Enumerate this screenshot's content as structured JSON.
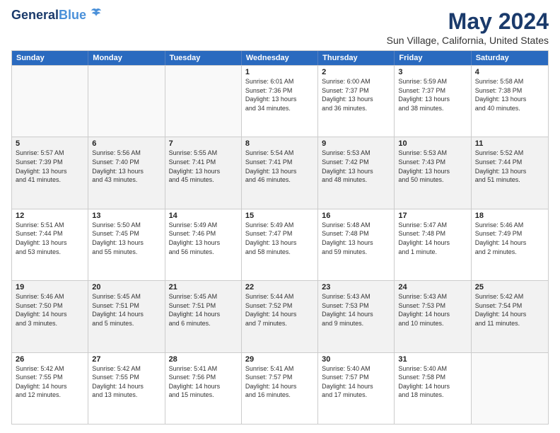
{
  "logo": {
    "line1": "General",
    "line2": "Blue"
  },
  "title": "May 2024",
  "subtitle": "Sun Village, California, United States",
  "headers": [
    "Sunday",
    "Monday",
    "Tuesday",
    "Wednesday",
    "Thursday",
    "Friday",
    "Saturday"
  ],
  "weeks": [
    [
      {
        "day": "",
        "info": ""
      },
      {
        "day": "",
        "info": ""
      },
      {
        "day": "",
        "info": ""
      },
      {
        "day": "1",
        "info": "Sunrise: 6:01 AM\nSunset: 7:36 PM\nDaylight: 13 hours\nand 34 minutes."
      },
      {
        "day": "2",
        "info": "Sunrise: 6:00 AM\nSunset: 7:37 PM\nDaylight: 13 hours\nand 36 minutes."
      },
      {
        "day": "3",
        "info": "Sunrise: 5:59 AM\nSunset: 7:37 PM\nDaylight: 13 hours\nand 38 minutes."
      },
      {
        "day": "4",
        "info": "Sunrise: 5:58 AM\nSunset: 7:38 PM\nDaylight: 13 hours\nand 40 minutes."
      }
    ],
    [
      {
        "day": "5",
        "info": "Sunrise: 5:57 AM\nSunset: 7:39 PM\nDaylight: 13 hours\nand 41 minutes."
      },
      {
        "day": "6",
        "info": "Sunrise: 5:56 AM\nSunset: 7:40 PM\nDaylight: 13 hours\nand 43 minutes."
      },
      {
        "day": "7",
        "info": "Sunrise: 5:55 AM\nSunset: 7:41 PM\nDaylight: 13 hours\nand 45 minutes."
      },
      {
        "day": "8",
        "info": "Sunrise: 5:54 AM\nSunset: 7:41 PM\nDaylight: 13 hours\nand 46 minutes."
      },
      {
        "day": "9",
        "info": "Sunrise: 5:53 AM\nSunset: 7:42 PM\nDaylight: 13 hours\nand 48 minutes."
      },
      {
        "day": "10",
        "info": "Sunrise: 5:53 AM\nSunset: 7:43 PM\nDaylight: 13 hours\nand 50 minutes."
      },
      {
        "day": "11",
        "info": "Sunrise: 5:52 AM\nSunset: 7:44 PM\nDaylight: 13 hours\nand 51 minutes."
      }
    ],
    [
      {
        "day": "12",
        "info": "Sunrise: 5:51 AM\nSunset: 7:44 PM\nDaylight: 13 hours\nand 53 minutes."
      },
      {
        "day": "13",
        "info": "Sunrise: 5:50 AM\nSunset: 7:45 PM\nDaylight: 13 hours\nand 55 minutes."
      },
      {
        "day": "14",
        "info": "Sunrise: 5:49 AM\nSunset: 7:46 PM\nDaylight: 13 hours\nand 56 minutes."
      },
      {
        "day": "15",
        "info": "Sunrise: 5:49 AM\nSunset: 7:47 PM\nDaylight: 13 hours\nand 58 minutes."
      },
      {
        "day": "16",
        "info": "Sunrise: 5:48 AM\nSunset: 7:48 PM\nDaylight: 13 hours\nand 59 minutes."
      },
      {
        "day": "17",
        "info": "Sunrise: 5:47 AM\nSunset: 7:48 PM\nDaylight: 14 hours\nand 1 minute."
      },
      {
        "day": "18",
        "info": "Sunrise: 5:46 AM\nSunset: 7:49 PM\nDaylight: 14 hours\nand 2 minutes."
      }
    ],
    [
      {
        "day": "19",
        "info": "Sunrise: 5:46 AM\nSunset: 7:50 PM\nDaylight: 14 hours\nand 3 minutes."
      },
      {
        "day": "20",
        "info": "Sunrise: 5:45 AM\nSunset: 7:51 PM\nDaylight: 14 hours\nand 5 minutes."
      },
      {
        "day": "21",
        "info": "Sunrise: 5:45 AM\nSunset: 7:51 PM\nDaylight: 14 hours\nand 6 minutes."
      },
      {
        "day": "22",
        "info": "Sunrise: 5:44 AM\nSunset: 7:52 PM\nDaylight: 14 hours\nand 7 minutes."
      },
      {
        "day": "23",
        "info": "Sunrise: 5:43 AM\nSunset: 7:53 PM\nDaylight: 14 hours\nand 9 minutes."
      },
      {
        "day": "24",
        "info": "Sunrise: 5:43 AM\nSunset: 7:53 PM\nDaylight: 14 hours\nand 10 minutes."
      },
      {
        "day": "25",
        "info": "Sunrise: 5:42 AM\nSunset: 7:54 PM\nDaylight: 14 hours\nand 11 minutes."
      }
    ],
    [
      {
        "day": "26",
        "info": "Sunrise: 5:42 AM\nSunset: 7:55 PM\nDaylight: 14 hours\nand 12 minutes."
      },
      {
        "day": "27",
        "info": "Sunrise: 5:42 AM\nSunset: 7:55 PM\nDaylight: 14 hours\nand 13 minutes."
      },
      {
        "day": "28",
        "info": "Sunrise: 5:41 AM\nSunset: 7:56 PM\nDaylight: 14 hours\nand 15 minutes."
      },
      {
        "day": "29",
        "info": "Sunrise: 5:41 AM\nSunset: 7:57 PM\nDaylight: 14 hours\nand 16 minutes."
      },
      {
        "day": "30",
        "info": "Sunrise: 5:40 AM\nSunset: 7:57 PM\nDaylight: 14 hours\nand 17 minutes."
      },
      {
        "day": "31",
        "info": "Sunrise: 5:40 AM\nSunset: 7:58 PM\nDaylight: 14 hours\nand 18 minutes."
      },
      {
        "day": "",
        "info": ""
      }
    ]
  ]
}
